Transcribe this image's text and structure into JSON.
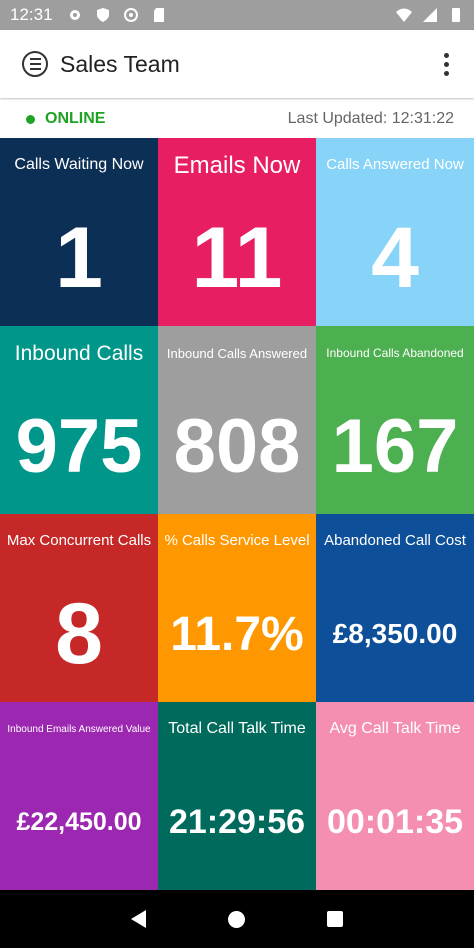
{
  "status_bar": {
    "time": "12:31",
    "left_icons": [
      "gear-icon",
      "shield-icon",
      "at-sign-icon",
      "sd-card-icon"
    ],
    "right_icons": [
      "wifi-icon",
      "cellular-icon",
      "battery-icon"
    ]
  },
  "app_bar": {
    "title": "Sales Team",
    "menu_icon": "menu-icon",
    "overflow_icon": "more-vert-icon"
  },
  "info_bar": {
    "status": "ONLINE",
    "status_color": "#1fa324",
    "last_updated": "Last Updated: 12:31:22"
  },
  "tiles": [
    {
      "label": "Calls Waiting Now",
      "value": "1",
      "color": "#0c2f55"
    },
    {
      "label": "Emails Now",
      "value": "11",
      "color": "#e81e63"
    },
    {
      "label": "Calls Answered Now",
      "value": "4",
      "color": "#87d4f8"
    },
    {
      "label": "Inbound Calls",
      "value": "975",
      "color": "#00968a"
    },
    {
      "label": "Inbound Calls Answered",
      "value": "808",
      "color": "#9e9e9e"
    },
    {
      "label": "Inbound Calls Abandoned",
      "value": "167",
      "color": "#4caf50"
    },
    {
      "label": "Max Concurrent Calls",
      "value": "8",
      "color": "#c62828"
    },
    {
      "label": "% Calls Service Level",
      "value": "11.7%",
      "color": "#ff9800"
    },
    {
      "label": "Abandoned Call Cost",
      "value": "£8,350.00",
      "color": "#0d4f98"
    },
    {
      "label": "Inbound Emails Answered Value",
      "value": "£22,450.00",
      "color": "#9c27b0"
    },
    {
      "label": "Total Call Talk Time",
      "value": "21:29:56",
      "color": "#006b5c"
    },
    {
      "label": "Avg Call Talk Time",
      "value": "00:01:35",
      "color": "#f48fb1"
    }
  ]
}
